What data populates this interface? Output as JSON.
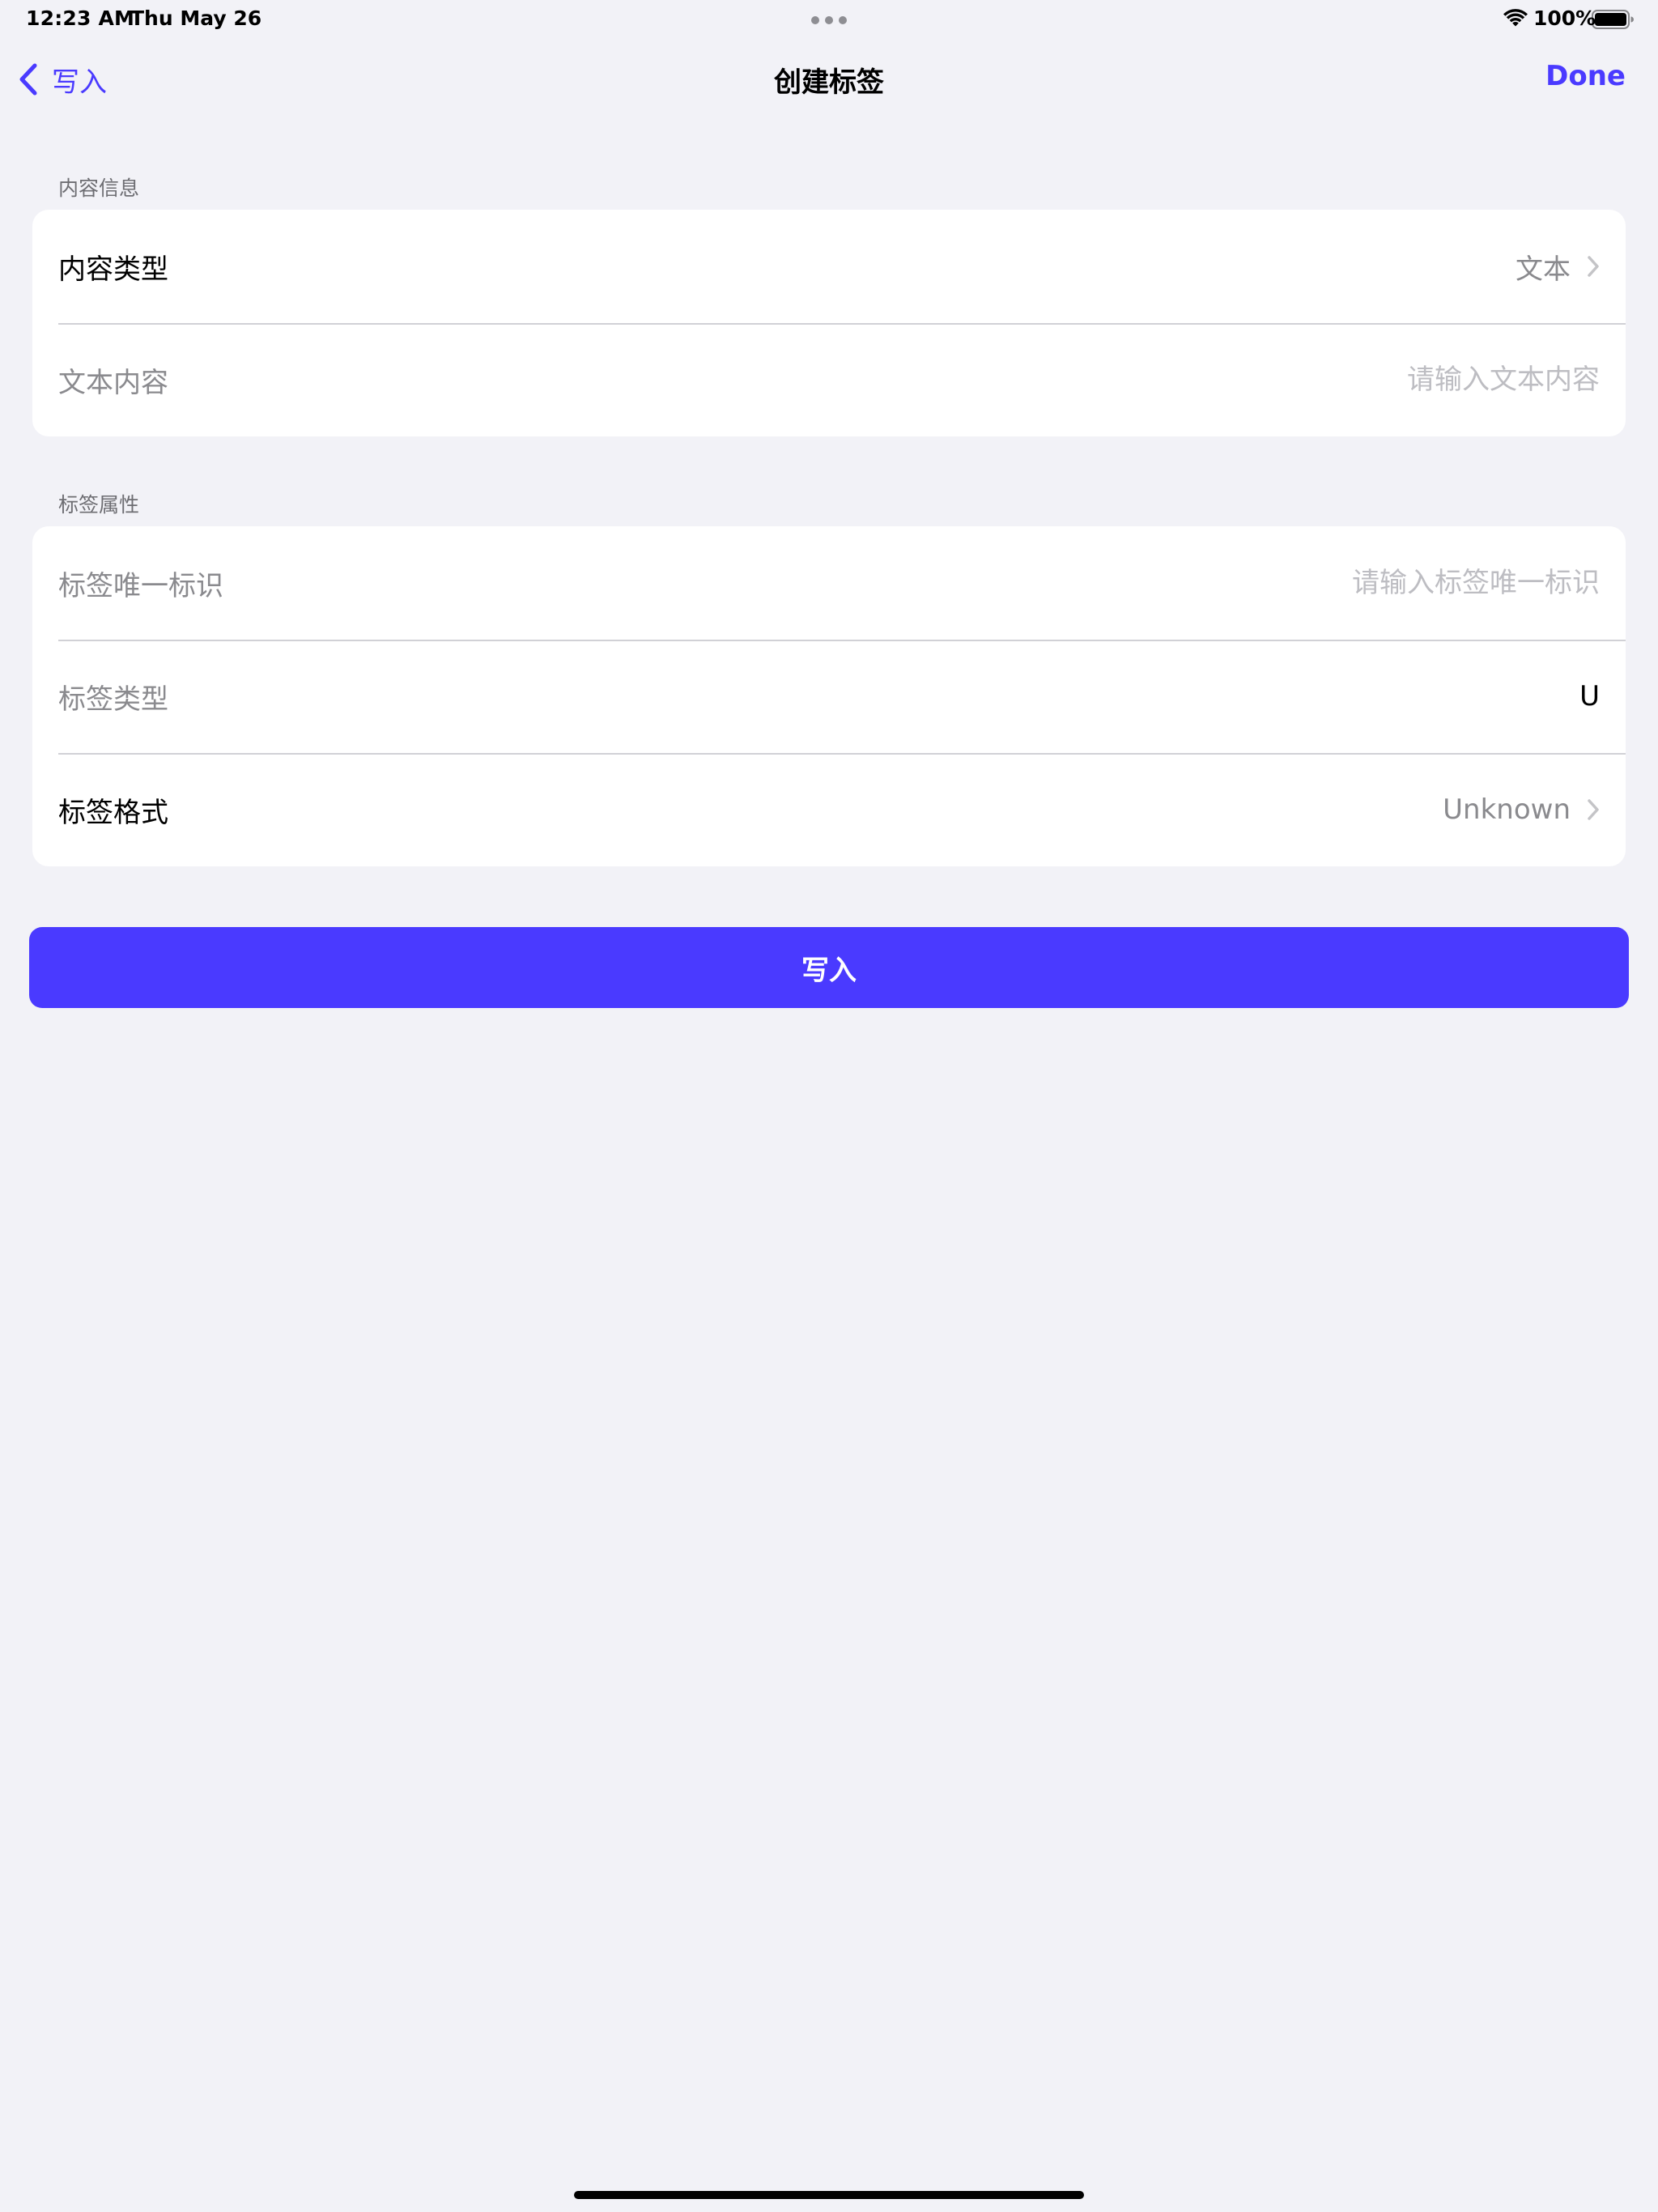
{
  "status_bar": {
    "time": "12:23 AM",
    "date": "Thu May 26",
    "battery": "100%"
  },
  "nav": {
    "back_label": "写入",
    "title": "创建标签",
    "done_label": "Done"
  },
  "sections": {
    "content_info": {
      "header": "内容信息",
      "content_type_label": "内容类型",
      "content_type_value": "文本",
      "text_content_label": "文本内容",
      "text_content_placeholder": "请输入文本内容",
      "text_content_value": ""
    },
    "tag_attributes": {
      "header": "标签属性",
      "tag_id_label": "标签唯一标识",
      "tag_id_placeholder": "请输入标签唯一标识",
      "tag_id_value": "",
      "tag_type_label": "标签类型",
      "tag_type_value": "U",
      "tag_format_label": "标签格式",
      "tag_format_value": "Unknown"
    }
  },
  "write_button_label": "写入",
  "colors": {
    "accent": "#4A3AFF",
    "background": "#F2F2F7",
    "card": "#FFFFFF",
    "secondary_text": "#8A8A8E",
    "placeholder": "#BDBDC2"
  },
  "icons": {
    "back": "chevron-left-icon",
    "disclosure": "chevron-right-icon",
    "wifi": "wifi-icon",
    "battery": "battery-icon",
    "multitask": "more-dots-icon"
  }
}
